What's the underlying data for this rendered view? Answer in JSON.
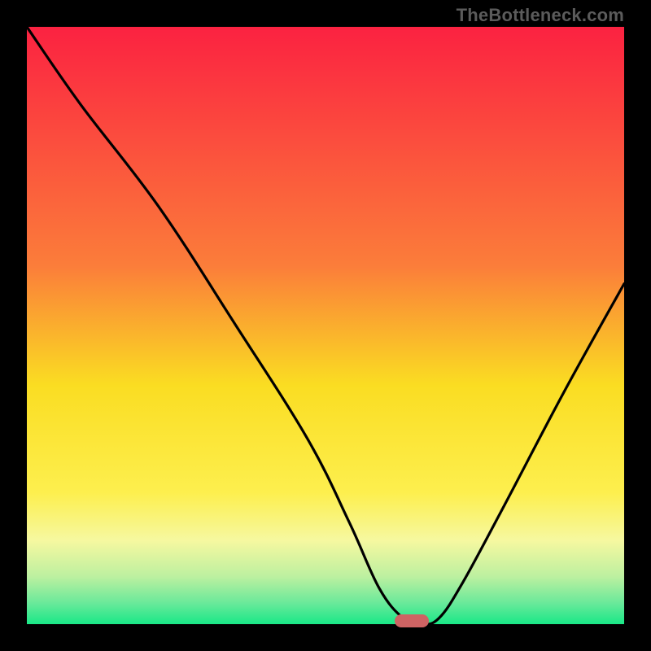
{
  "watermark": "TheBottleneck.com",
  "colors": {
    "frame": "#000000",
    "top": "#fb2241",
    "yellow_mid": "#fadd22",
    "green_bottom": "#19e887",
    "curve": "#000000",
    "marker": "#ce6363"
  },
  "chart_data": {
    "type": "line",
    "title": "",
    "xlabel": "",
    "ylabel": "",
    "xlim": [
      0,
      100
    ],
    "ylim": [
      0,
      100
    ],
    "series": [
      {
        "name": "bottleneck-curve",
        "x": [
          0,
          9,
          22,
          35,
          47,
          54,
          59,
          63,
          66,
          69,
          73,
          80,
          90,
          100
        ],
        "y": [
          100,
          87,
          70,
          50,
          31,
          17,
          6,
          1,
          0,
          1,
          7,
          20,
          39,
          57
        ]
      }
    ],
    "marker": {
      "x": 64.5,
      "y": 0.5,
      "shape": "pill"
    },
    "gradient_stops": [
      {
        "offset": 0.0,
        "color": "#fb2241"
      },
      {
        "offset": 0.4,
        "color": "#fb7d3a"
      },
      {
        "offset": 0.6,
        "color": "#fadd22"
      },
      {
        "offset": 0.78,
        "color": "#fdef4e"
      },
      {
        "offset": 0.86,
        "color": "#f6f8a0"
      },
      {
        "offset": 0.92,
        "color": "#bdf0a0"
      },
      {
        "offset": 0.965,
        "color": "#69e99a"
      },
      {
        "offset": 1.0,
        "color": "#19e887"
      }
    ]
  }
}
